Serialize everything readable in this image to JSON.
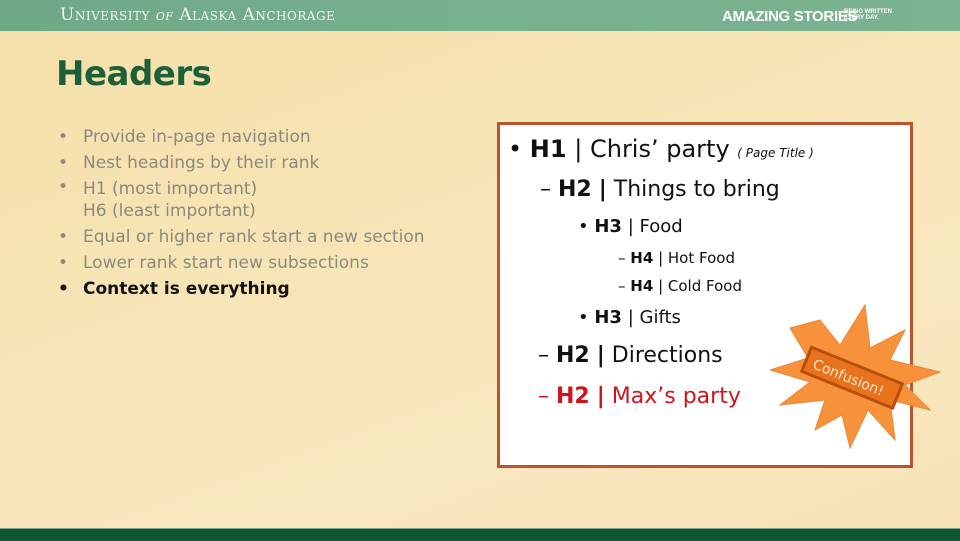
{
  "header": {
    "university": [
      "University",
      "of",
      "Alaska Anchorage"
    ],
    "slogan": "AMAZING STORIES",
    "tagline": "BEING WRITTEN EVERY DAY."
  },
  "slide": {
    "title": "Headers",
    "bullets": [
      {
        "text": "Provide in-page navigation",
        "emphasis": false
      },
      {
        "text": "Nest headings by their rank",
        "emphasis": false
      },
      {
        "text": "H1 (most important)",
        "emphasis": false,
        "continuation": "H6 (least important)"
      },
      {
        "text": "Equal or higher rank start a new section",
        "emphasis": false
      },
      {
        "text": "Lower rank start new subsections",
        "emphasis": false
      },
      {
        "text": "Context is everything",
        "emphasis": true
      }
    ],
    "bullet_glyph": "•",
    "example": {
      "items": [
        {
          "marker": "•",
          "level": "H1",
          "sep": "|",
          "text": "Chris’ party",
          "note": "( Page Title )"
        },
        {
          "marker": "–",
          "level": "H2",
          "sep": "|",
          "text": "Things to bring"
        },
        {
          "marker": "•",
          "level": "H3",
          "sep": "|",
          "text": "Food"
        },
        {
          "marker": "–",
          "level": "H4",
          "sep": "|",
          "text": "Hot Food"
        },
        {
          "marker": "–",
          "level": "H4",
          "sep": "|",
          "text": "Cold Food"
        },
        {
          "marker": "•",
          "level": "H3",
          "sep": "|",
          "text": "Gifts"
        },
        {
          "marker": "–",
          "level": "H2",
          "sep": "|",
          "text": "Directions"
        },
        {
          "marker": "–",
          "level": "H2",
          "sep": "|",
          "text": "Max’s party",
          "color": "#d0141b"
        }
      ]
    },
    "callout": {
      "text": "Confusion!",
      "color": "#f7923a",
      "label_color": "#e5701a"
    }
  }
}
